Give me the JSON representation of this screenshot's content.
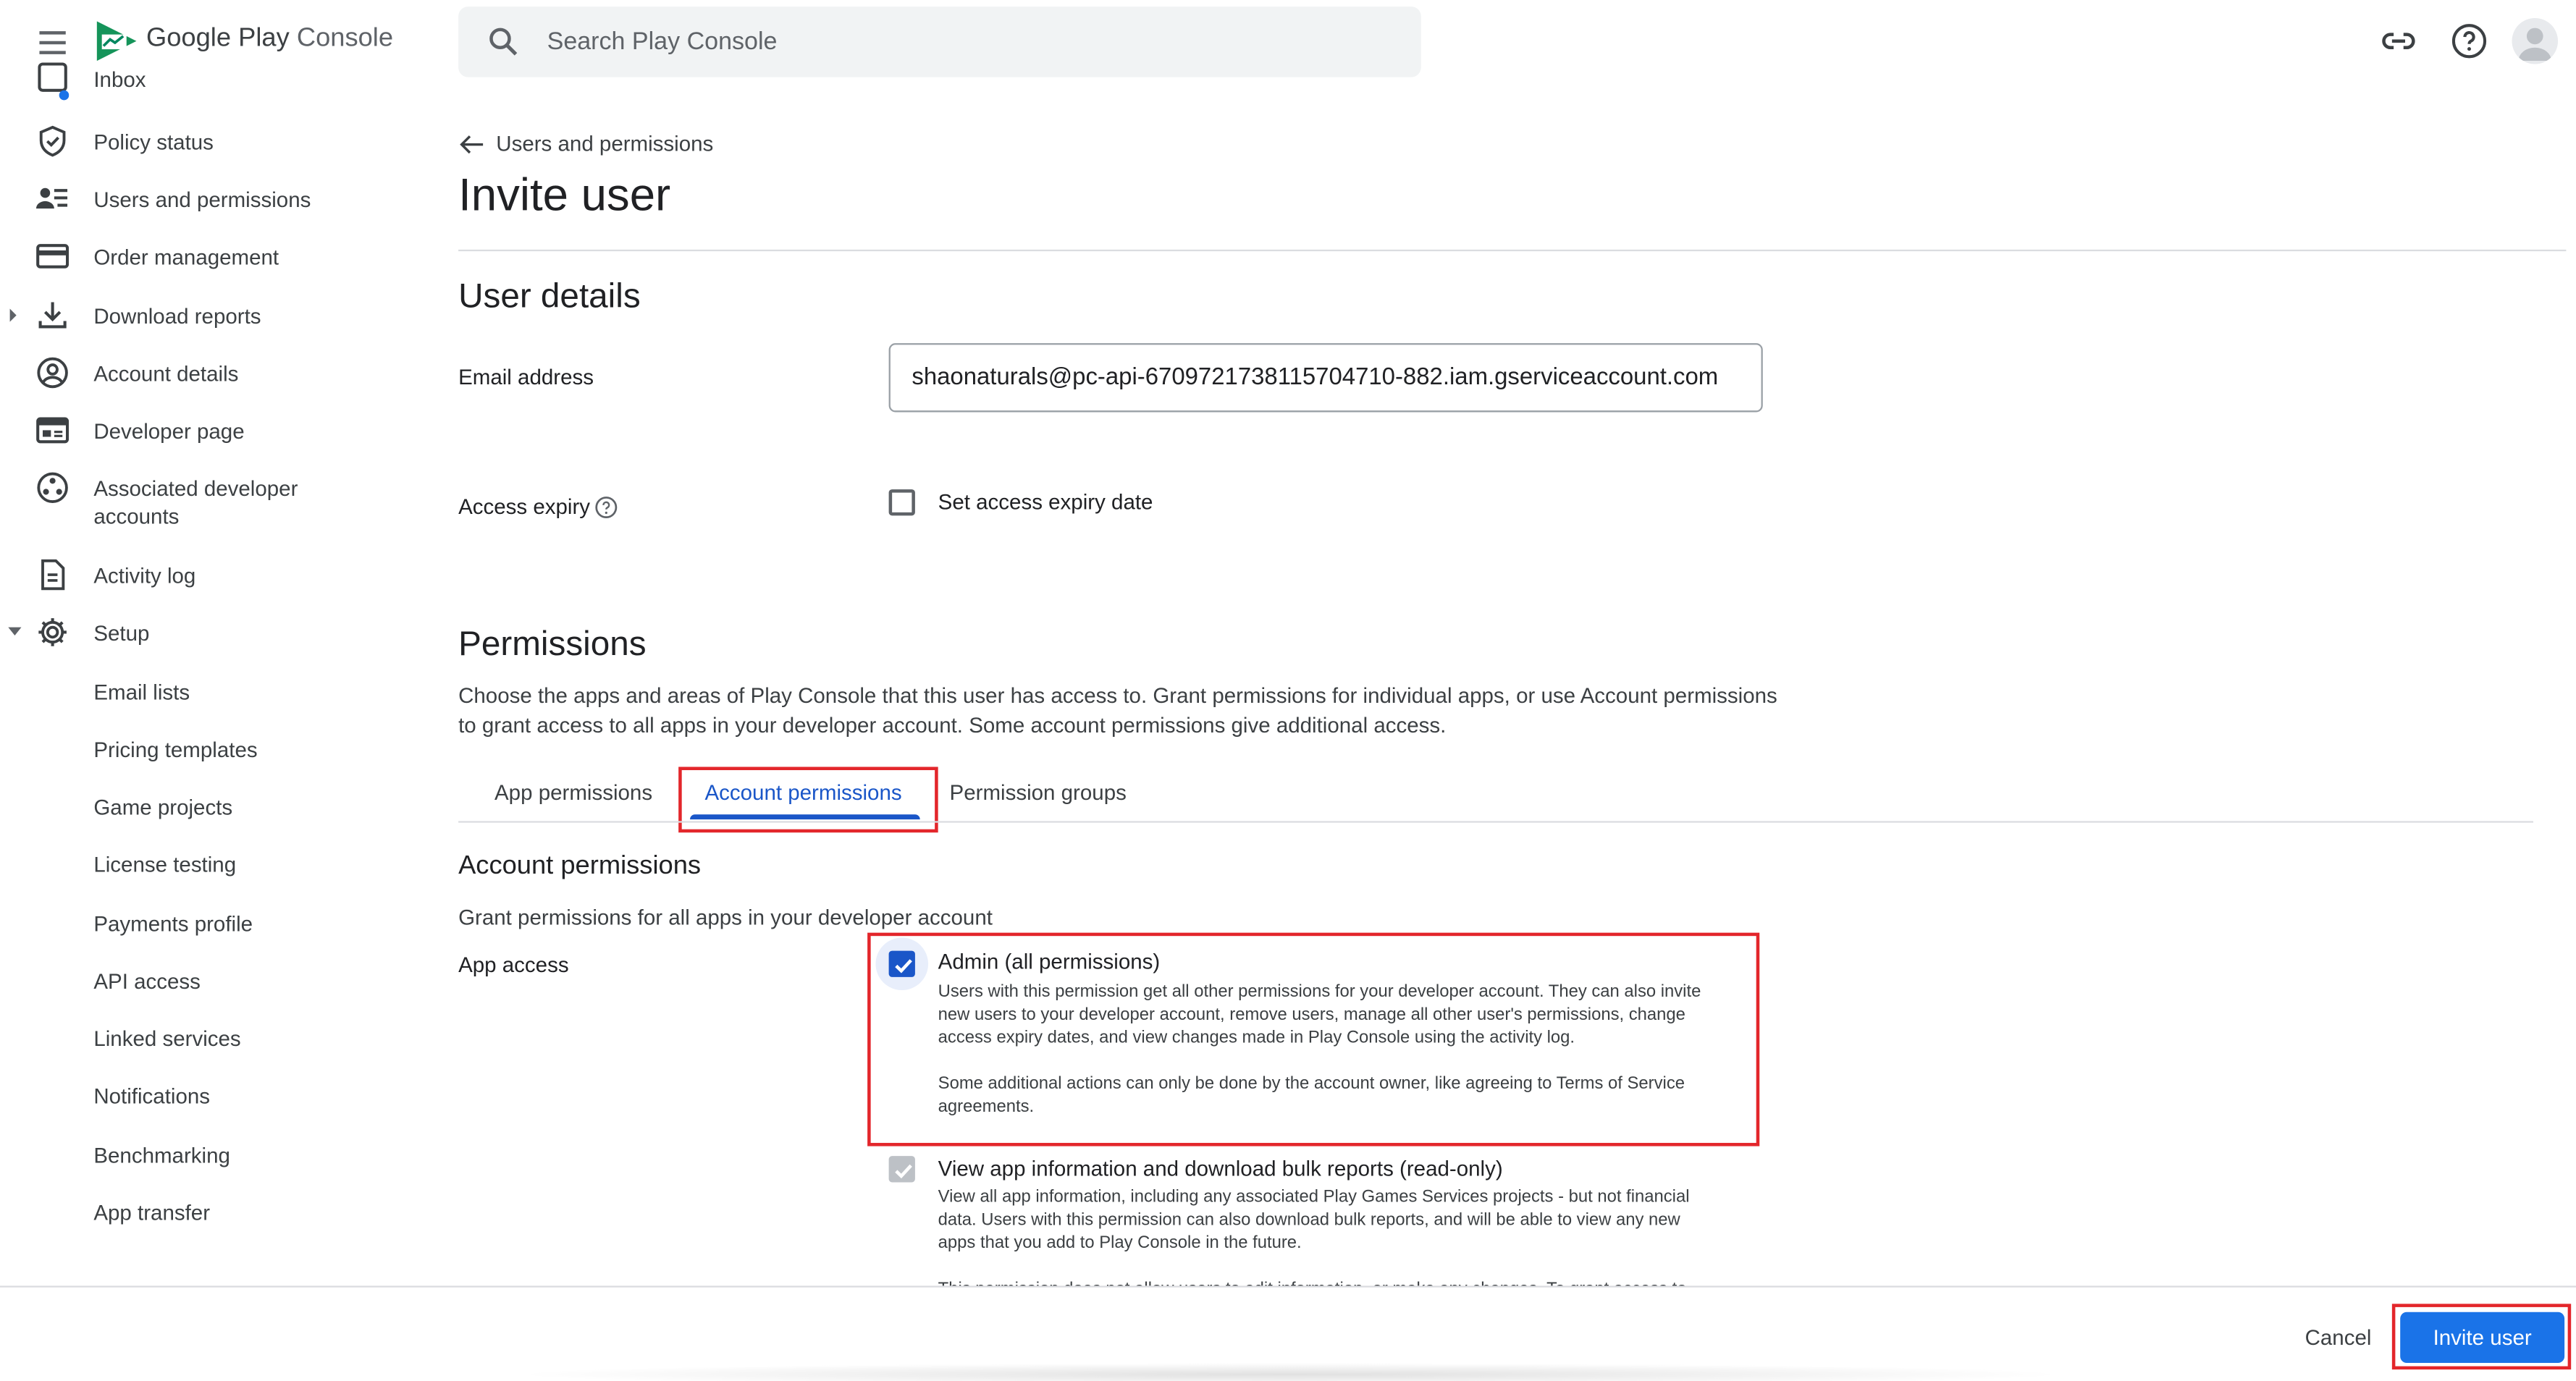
{
  "app": {
    "brand_prefix": "Google Play",
    "brand_suffix": "Console",
    "search_placeholder": "Search Play Console"
  },
  "sidebar": {
    "partial_item": "Inbox",
    "items": [
      {
        "label": "Policy status",
        "icon": "shield-check-icon"
      },
      {
        "label": "Users and permissions",
        "icon": "users-list-icon"
      },
      {
        "label": "Order management",
        "icon": "credit-card-icon"
      },
      {
        "label": "Download reports",
        "icon": "download-icon"
      },
      {
        "label": "Account details",
        "icon": "account-circle-icon"
      },
      {
        "label": "Developer page",
        "icon": "web-page-icon"
      },
      {
        "label": "Associated developer accounts",
        "icon": "linked-accounts-icon"
      },
      {
        "label": "Activity log",
        "icon": "document-icon"
      },
      {
        "label": "Setup",
        "icon": "gear-icon"
      }
    ],
    "setup_items": [
      "Email lists",
      "Pricing templates",
      "Game projects",
      "License testing",
      "Payments profile",
      "API access",
      "Linked services",
      "Notifications",
      "Benchmarking",
      "App transfer"
    ]
  },
  "main": {
    "back_label": "Users and permissions",
    "title": "Invite user",
    "user_details_heading": "User details",
    "email_label": "Email address",
    "email_value": "shaonaturals@pc-api-6709721738115704710-882.iam.gserviceaccount.com",
    "access_expiry_label": "Access expiry",
    "access_expiry_checkbox": "Set access expiry date",
    "permissions_heading": "Permissions",
    "permissions_desc_1": "Choose the apps and areas of Play Console that this user has access to. Grant permissions for individual apps, or use Account permissions",
    "permissions_desc_2": "to grant access to all apps in your developer account. Some account permissions give additional access.",
    "tabs": [
      "App permissions",
      "Account permissions",
      "Permission groups"
    ],
    "account_permissions_heading": "Account permissions",
    "account_permissions_desc": "Grant permissions for all apps in your developer account",
    "app_access_label": "App access",
    "admin": {
      "title": "Admin (all permissions)",
      "checked": true,
      "desc_lines": [
        "Users with this permission get all other permissions for your developer account. They can also invite",
        "new users to your developer account, remove users, manage all other user's permissions, change",
        "access expiry dates, and view changes made in Play Console using the activity log."
      ],
      "note_lines": [
        "Some additional actions can only be done by the account owner, like agreeing to Terms of Service",
        "agreements."
      ]
    },
    "view_app_info": {
      "title": "View app information and download bulk reports (read-only)",
      "checked": true,
      "desc_lines": [
        "View all app information, including any associated Play Games Services projects - but not financial",
        "data. Users with this permission can also download bulk reports, and will be able to view any new",
        "apps that you add to Play Console in the future."
      ],
      "cut_line": "This permission does not allow users to edit information, or make any changes. To grant access to"
    }
  },
  "footer": {
    "cancel_label": "Cancel",
    "invite_label": "Invite user"
  },
  "colors": {
    "accent": "#1a73e8",
    "active_tab": "#1a56c8",
    "highlight_box": "#e3262b"
  }
}
